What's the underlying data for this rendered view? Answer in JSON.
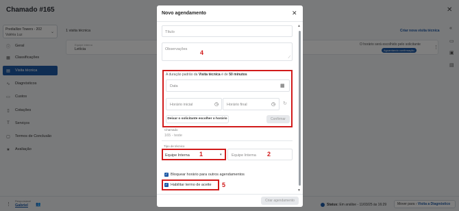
{
  "page": {
    "title": "Chamado #165",
    "close_symbol": "✕"
  },
  "sidebar": {
    "client_name": "Prediallize Towers - 202",
    "client_sub": "Valéria Luz",
    "items": [
      {
        "label": "Geral",
        "icon": "info-icon",
        "glyph": "ⓘ"
      },
      {
        "label": "Classificações",
        "icon": "grid-icon",
        "glyph": "▦"
      },
      {
        "label": "Visita técnica",
        "icon": "calendar-icon",
        "glyph": "▤",
        "active": true
      },
      {
        "label": "Diagnósticos",
        "icon": "pulse-icon",
        "glyph": "∿"
      },
      {
        "label": "Custos",
        "icon": "wallet-icon",
        "glyph": "▭"
      },
      {
        "label": "Cotações",
        "icon": "document-icon",
        "glyph": "▯"
      },
      {
        "label": "Serviços",
        "icon": "hammer-icon",
        "glyph": "T"
      },
      {
        "label": "Termos de Conclusão",
        "icon": "file-icon",
        "glyph": "▢"
      },
      {
        "label": "Avaliação",
        "icon": "star-icon",
        "glyph": "★"
      }
    ]
  },
  "content": {
    "visit_count": "1 visita técnica",
    "create_link": "Criar nova visita técnica",
    "card": {
      "team_label": "Equipe interna",
      "team_value": "Letícia",
      "solicit_text": "O horário será escolhido pelo solicitante",
      "badge": "Aguardando confirmação"
    }
  },
  "bottombar": {
    "responsible_label": "Responsável",
    "responsible_value": "Gabriel",
    "status_label": "Status:",
    "status_value": "Em análise - 11/03/25 às 16:29",
    "move_label": "Mover para",
    "move_link": "Visita a Diagnóstico"
  },
  "modal": {
    "title": "Novo agendamento",
    "title_placeholder": "Título",
    "obs_placeholder": "Observações",
    "duration_prefix": "A duração padrão da",
    "duration_type": "Visita técnica",
    "duration_mid": "é de",
    "duration_value": "50 minutos",
    "date_placeholder": "Data",
    "start_placeholder": "Horário inicial",
    "end_placeholder": "Horário final",
    "let_requester_button": "Deixar o solicitante escolher o horário",
    "confirm_small": "Confirmar",
    "chamado_label": "Chamado",
    "chamado_value": "165 - teste",
    "type_label": "Tipo de técnico",
    "type_value": "Equipe Interna",
    "team_placeholder": "Equipe Interna",
    "block_checkbox": "Bloquear horário para outros agendamentos",
    "accept_checkbox": "Habilitar termo de aceite",
    "create_button": "Criar agendamento"
  },
  "annotations": {
    "n1": "1",
    "n2": "2",
    "n3": "3",
    "n4": "4",
    "n5": "5",
    "color": "#d11a1a"
  }
}
